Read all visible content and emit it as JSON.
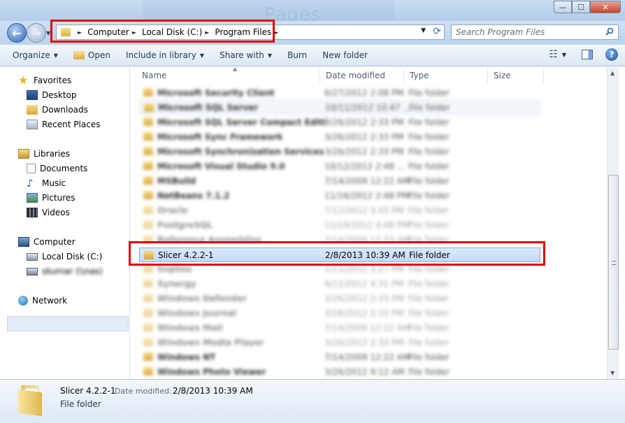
{
  "window": {
    "title_ghost": "Pages",
    "minimize_glyph": "—",
    "maximize_glyph": "☐",
    "close_glyph": "✕"
  },
  "nav": {
    "back_glyph": "←",
    "forward_glyph": "→",
    "history_dd": "▼",
    "refresh_glyph": "⟳"
  },
  "address": {
    "crumbs": [
      "Computer",
      "Local Disk (C:)",
      "Program Files"
    ],
    "arrow": "►",
    "dropdown": "▼"
  },
  "search": {
    "placeholder": "Search Program Files"
  },
  "toolbar": {
    "organize": "Organize",
    "open": "Open",
    "include_in_library": "Include in library",
    "share_with": "Share with",
    "burn": "Burn",
    "new_folder": "New folder",
    "dd": "▼",
    "views_glyph": "☷",
    "help_glyph": "?"
  },
  "sidebar": {
    "favorites": "Favorites",
    "desktop": "Desktop",
    "downloads": "Downloads",
    "recent_places": "Recent Places",
    "libraries": "Libraries",
    "documents": "Documents",
    "music": "Music",
    "pictures": "Pictures",
    "videos": "Videos",
    "computer": "Computer",
    "local_disk": "Local Disk (C:)",
    "network_drive": "skumar (\\\\nas)",
    "network": "Network"
  },
  "columns": {
    "name": "Name",
    "date_modified": "Date modified",
    "type": "Type",
    "size": "Size",
    "sort_glyph": "▲"
  },
  "files": [
    {
      "name": "Microsoft Security Client",
      "date": "6/27/2012 2:08 PM",
      "type": "File folder",
      "style": "blur"
    },
    {
      "name": "Microsoft SQL Server",
      "date": "10/11/2012 10:47 ...",
      "type": "File folder",
      "style": "blur-hover"
    },
    {
      "name": "Microsoft SQL Server Compact Edition",
      "date": "3/26/2012 2:33 PM",
      "type": "File folder",
      "style": "blur"
    },
    {
      "name": "Microsoft Sync Framework",
      "date": "3/26/2012 2:33 PM",
      "type": "File folder",
      "style": "blur"
    },
    {
      "name": "Microsoft Synchronization Services",
      "date": "3/26/2012 2:33 PM",
      "type": "File folder",
      "style": "blur"
    },
    {
      "name": "Microsoft Visual Studio 9.0",
      "date": "10/12/2012 2:48 ...",
      "type": "File folder",
      "style": "blur"
    },
    {
      "name": "MSBuild",
      "date": "7/14/2009 12:22 AM",
      "type": "File folder",
      "style": "blur"
    },
    {
      "name": "NetBeans 7.1.2",
      "date": "11/16/2012 2:48 PM",
      "type": "File folder",
      "style": "blur"
    },
    {
      "name": "Oracle",
      "date": "7/12/2012 3:45 PM",
      "type": "File folder",
      "style": "blur-faded"
    },
    {
      "name": "PostgreSQL",
      "date": "11/19/2012 4:48 PM",
      "type": "File folder",
      "style": "blur-faded"
    },
    {
      "name": "Reference Assemblies",
      "date": "7/14/2009 12:33 AM",
      "type": "File folder",
      "style": "blur-faded"
    },
    {
      "name": "Slicer 4.2.2-1",
      "date": "2/8/2013 10:39 AM",
      "type": "File folder",
      "style": "selected"
    },
    {
      "name": "Sophos",
      "date": "1/11/2012 3:27 PM",
      "type": "File folder",
      "style": "blur-faded"
    },
    {
      "name": "Synergy",
      "date": "6/11/2012 4:31 PM",
      "type": "File folder",
      "style": "blur-faded"
    },
    {
      "name": "Windows Defender",
      "date": "3/26/2012 2:33 PM",
      "type": "File folder",
      "style": "blur-faded"
    },
    {
      "name": "Windows Journal",
      "date": "3/26/2012 2:33 PM",
      "type": "File folder",
      "style": "blur-faded"
    },
    {
      "name": "Windows Mail",
      "date": "7/14/2009 12:22 AM",
      "type": "File folder",
      "style": "blur-faded"
    },
    {
      "name": "Windows Media Player",
      "date": "3/26/2012 2:33 PM",
      "type": "File folder",
      "style": "blur-faded"
    },
    {
      "name": "Windows NT",
      "date": "7/14/2009 12:22 AM",
      "type": "File folder",
      "style": "blur"
    },
    {
      "name": "Windows Photo Viewer",
      "date": "3/26/2012 9:12 AM",
      "type": "File folder",
      "style": "blur"
    }
  ],
  "details": {
    "name": "Slicer 4.2.2-1",
    "date_label": "Date modified:",
    "date_value": "2/8/2013 10:39 AM",
    "type": "File folder"
  },
  "scrollbar": {
    "up": "▲",
    "down": "▼"
  },
  "colors": {
    "highlight_box": "#e00000",
    "selection": "#c1dbfc"
  }
}
